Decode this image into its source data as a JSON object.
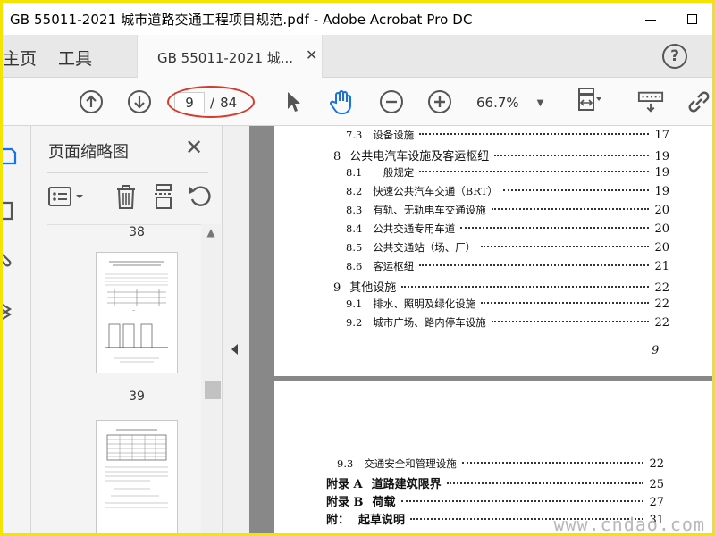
{
  "window": {
    "title": "GB 55011-2021 城市道路交通工程项目规范.pdf - Adobe Acrobat Pro DC"
  },
  "tabs": {
    "home": "主页",
    "tools": "工具",
    "document": "GB 55011-2021 城...",
    "help": "?"
  },
  "toolbar": {
    "current_page": "9",
    "page_sep": "/",
    "total_pages": "84",
    "zoom": "66.7%"
  },
  "thumb_panel": {
    "title": "页面缩略图",
    "pages": [
      "38",
      "39"
    ]
  },
  "toc_page1": {
    "rows": [
      {
        "num": "7.3",
        "text": "设备设施",
        "page": "17",
        "level": 2
      },
      {
        "num": "8",
        "text": "公共电汽车设施及客运枢纽",
        "page": "19",
        "level": 1
      },
      {
        "num": "8.1",
        "text": "一般规定",
        "page": "19",
        "level": 2
      },
      {
        "num": "8.2",
        "text": "快速公共汽车交通（BRT）",
        "page": "19",
        "level": 2
      },
      {
        "num": "8.3",
        "text": "有轨、无轨电车交通设施",
        "page": "20",
        "level": 2
      },
      {
        "num": "8.4",
        "text": "公共交通专用车道",
        "page": "20",
        "level": 2
      },
      {
        "num": "8.5",
        "text": "公共交通站（场、厂）",
        "page": "20",
        "level": 2
      },
      {
        "num": "8.6",
        "text": "客运枢纽",
        "page": "21",
        "level": 2
      },
      {
        "num": "9",
        "text": "其他设施",
        "page": "22",
        "level": 1
      },
      {
        "num": "9.1",
        "text": "排水、照明及绿化设施",
        "page": "22",
        "level": 2
      },
      {
        "num": "9.2",
        "text": "城市广场、路内停车设施",
        "page": "22",
        "level": 2
      }
    ],
    "page_number": "9"
  },
  "toc_page2": {
    "rows": [
      {
        "num": "9.3",
        "text": "交通安全和管理设施",
        "page": "22",
        "level": 2
      },
      {
        "num": "附录 A",
        "text": "道路建筑限界",
        "page": "25",
        "level": 1
      },
      {
        "num": "附录 B",
        "text": "荷载",
        "page": "27",
        "level": 1
      },
      {
        "num": "附：",
        "text": "起草说明",
        "page": "31",
        "level": 1
      }
    ]
  },
  "watermark": "www.cndao.com",
  "colors": {
    "annotation": "#d63a2f",
    "frame": "#f5e400",
    "hand_tool": "#1473e6"
  }
}
